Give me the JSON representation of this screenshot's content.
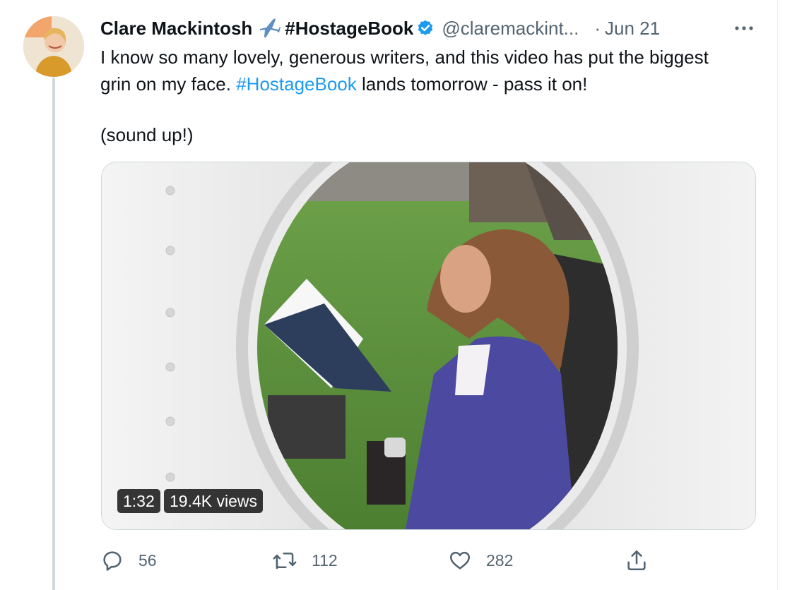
{
  "tweet": {
    "author_name": "Clare Mackintosh",
    "author_hashtag": "#HostageBook",
    "handle": "@claremackint...",
    "separator": "·",
    "date": "Jun 21",
    "text_line1_before": "I know so many lovely, generous writers, and this video has put the biggest grin on my face. ",
    "text_hashtag": "#HostageBook",
    "text_line1_after": " lands tomorrow - pass it on!",
    "text_line2": "(sound up!)"
  },
  "video": {
    "duration": "1:32",
    "views": "19.4K views"
  },
  "actions": {
    "replies": "56",
    "retweets": "112",
    "likes": "282"
  },
  "icons": [
    "airplane-emoji-icon",
    "verified-badge-icon",
    "more-icon",
    "reply-icon",
    "retweet-icon",
    "like-icon",
    "share-icon"
  ],
  "colors": {
    "accent": "#1d9bf0",
    "secondary_text": "#536471",
    "border": "#cfd9de"
  }
}
